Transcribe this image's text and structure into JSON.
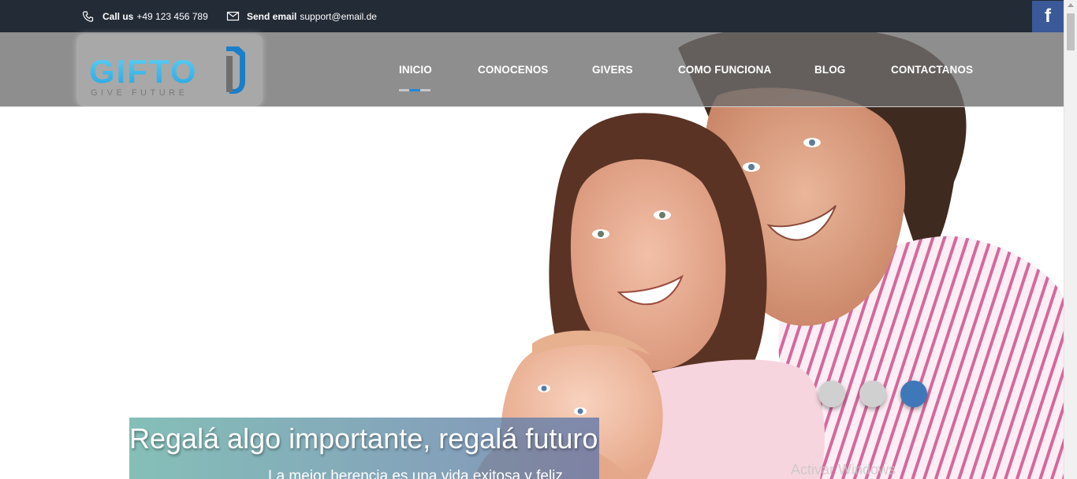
{
  "topbar": {
    "call_label": "Call us",
    "call_value": "+49 123 456 789",
    "email_label": "Send email",
    "email_value": "support@email.de",
    "facebook_glyph": "f"
  },
  "header": {
    "logo_text": "GIFTO",
    "logo_tagline": "GIVE FUTURE",
    "nav": [
      {
        "label": "INICIO",
        "active": true
      },
      {
        "label": "CONOCENOS",
        "active": false
      },
      {
        "label": "GIVERS",
        "active": false
      },
      {
        "label": "COMO FUNCIONA",
        "active": false
      },
      {
        "label": "BLOG",
        "active": false
      },
      {
        "label": "CONTACTANOS",
        "active": false
      }
    ]
  },
  "hero": {
    "title": "Regalá algo importante, regalá futuro",
    "subtitle": "La mejor herencia es una vida exitosa y feliz",
    "slides": 3,
    "active_slide": 3
  },
  "watermark": "Activar Windows",
  "colors": {
    "topbar_bg": "#232b36",
    "facebook": "#3b5998",
    "accent": "#1f8ad8",
    "active_dot": "#3f78b9"
  }
}
